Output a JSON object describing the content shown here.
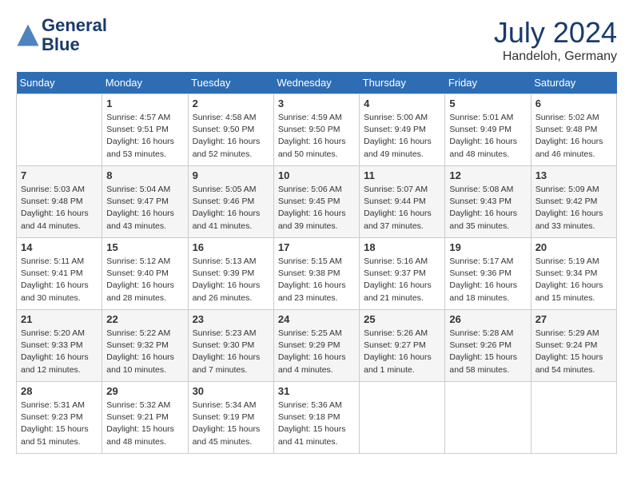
{
  "header": {
    "logo_line1": "General",
    "logo_line2": "Blue",
    "month_year": "July 2024",
    "location": "Handeloh, Germany"
  },
  "calendar": {
    "days_of_week": [
      "Sunday",
      "Monday",
      "Tuesday",
      "Wednesday",
      "Thursday",
      "Friday",
      "Saturday"
    ],
    "weeks": [
      [
        {
          "day": "",
          "sunrise": "",
          "sunset": "",
          "daylight": ""
        },
        {
          "day": "1",
          "sunrise": "Sunrise: 4:57 AM",
          "sunset": "Sunset: 9:51 PM",
          "daylight": "Daylight: 16 hours and 53 minutes."
        },
        {
          "day": "2",
          "sunrise": "Sunrise: 4:58 AM",
          "sunset": "Sunset: 9:50 PM",
          "daylight": "Daylight: 16 hours and 52 minutes."
        },
        {
          "day": "3",
          "sunrise": "Sunrise: 4:59 AM",
          "sunset": "Sunset: 9:50 PM",
          "daylight": "Daylight: 16 hours and 50 minutes."
        },
        {
          "day": "4",
          "sunrise": "Sunrise: 5:00 AM",
          "sunset": "Sunset: 9:49 PM",
          "daylight": "Daylight: 16 hours and 49 minutes."
        },
        {
          "day": "5",
          "sunrise": "Sunrise: 5:01 AM",
          "sunset": "Sunset: 9:49 PM",
          "daylight": "Daylight: 16 hours and 48 minutes."
        },
        {
          "day": "6",
          "sunrise": "Sunrise: 5:02 AM",
          "sunset": "Sunset: 9:48 PM",
          "daylight": "Daylight: 16 hours and 46 minutes."
        }
      ],
      [
        {
          "day": "7",
          "sunrise": "Sunrise: 5:03 AM",
          "sunset": "Sunset: 9:48 PM",
          "daylight": "Daylight: 16 hours and 44 minutes."
        },
        {
          "day": "8",
          "sunrise": "Sunrise: 5:04 AM",
          "sunset": "Sunset: 9:47 PM",
          "daylight": "Daylight: 16 hours and 43 minutes."
        },
        {
          "day": "9",
          "sunrise": "Sunrise: 5:05 AM",
          "sunset": "Sunset: 9:46 PM",
          "daylight": "Daylight: 16 hours and 41 minutes."
        },
        {
          "day": "10",
          "sunrise": "Sunrise: 5:06 AM",
          "sunset": "Sunset: 9:45 PM",
          "daylight": "Daylight: 16 hours and 39 minutes."
        },
        {
          "day": "11",
          "sunrise": "Sunrise: 5:07 AM",
          "sunset": "Sunset: 9:44 PM",
          "daylight": "Daylight: 16 hours and 37 minutes."
        },
        {
          "day": "12",
          "sunrise": "Sunrise: 5:08 AM",
          "sunset": "Sunset: 9:43 PM",
          "daylight": "Daylight: 16 hours and 35 minutes."
        },
        {
          "day": "13",
          "sunrise": "Sunrise: 5:09 AM",
          "sunset": "Sunset: 9:42 PM",
          "daylight": "Daylight: 16 hours and 33 minutes."
        }
      ],
      [
        {
          "day": "14",
          "sunrise": "Sunrise: 5:11 AM",
          "sunset": "Sunset: 9:41 PM",
          "daylight": "Daylight: 16 hours and 30 minutes."
        },
        {
          "day": "15",
          "sunrise": "Sunrise: 5:12 AM",
          "sunset": "Sunset: 9:40 PM",
          "daylight": "Daylight: 16 hours and 28 minutes."
        },
        {
          "day": "16",
          "sunrise": "Sunrise: 5:13 AM",
          "sunset": "Sunset: 9:39 PM",
          "daylight": "Daylight: 16 hours and 26 minutes."
        },
        {
          "day": "17",
          "sunrise": "Sunrise: 5:15 AM",
          "sunset": "Sunset: 9:38 PM",
          "daylight": "Daylight: 16 hours and 23 minutes."
        },
        {
          "day": "18",
          "sunrise": "Sunrise: 5:16 AM",
          "sunset": "Sunset: 9:37 PM",
          "daylight": "Daylight: 16 hours and 21 minutes."
        },
        {
          "day": "19",
          "sunrise": "Sunrise: 5:17 AM",
          "sunset": "Sunset: 9:36 PM",
          "daylight": "Daylight: 16 hours and 18 minutes."
        },
        {
          "day": "20",
          "sunrise": "Sunrise: 5:19 AM",
          "sunset": "Sunset: 9:34 PM",
          "daylight": "Daylight: 16 hours and 15 minutes."
        }
      ],
      [
        {
          "day": "21",
          "sunrise": "Sunrise: 5:20 AM",
          "sunset": "Sunset: 9:33 PM",
          "daylight": "Daylight: 16 hours and 12 minutes."
        },
        {
          "day": "22",
          "sunrise": "Sunrise: 5:22 AM",
          "sunset": "Sunset: 9:32 PM",
          "daylight": "Daylight: 16 hours and 10 minutes."
        },
        {
          "day": "23",
          "sunrise": "Sunrise: 5:23 AM",
          "sunset": "Sunset: 9:30 PM",
          "daylight": "Daylight: 16 hours and 7 minutes."
        },
        {
          "day": "24",
          "sunrise": "Sunrise: 5:25 AM",
          "sunset": "Sunset: 9:29 PM",
          "daylight": "Daylight: 16 hours and 4 minutes."
        },
        {
          "day": "25",
          "sunrise": "Sunrise: 5:26 AM",
          "sunset": "Sunset: 9:27 PM",
          "daylight": "Daylight: 16 hours and 1 minute."
        },
        {
          "day": "26",
          "sunrise": "Sunrise: 5:28 AM",
          "sunset": "Sunset: 9:26 PM",
          "daylight": "Daylight: 15 hours and 58 minutes."
        },
        {
          "day": "27",
          "sunrise": "Sunrise: 5:29 AM",
          "sunset": "Sunset: 9:24 PM",
          "daylight": "Daylight: 15 hours and 54 minutes."
        }
      ],
      [
        {
          "day": "28",
          "sunrise": "Sunrise: 5:31 AM",
          "sunset": "Sunset: 9:23 PM",
          "daylight": "Daylight: 15 hours and 51 minutes."
        },
        {
          "day": "29",
          "sunrise": "Sunrise: 5:32 AM",
          "sunset": "Sunset: 9:21 PM",
          "daylight": "Daylight: 15 hours and 48 minutes."
        },
        {
          "day": "30",
          "sunrise": "Sunrise: 5:34 AM",
          "sunset": "Sunset: 9:19 PM",
          "daylight": "Daylight: 15 hours and 45 minutes."
        },
        {
          "day": "31",
          "sunrise": "Sunrise: 5:36 AM",
          "sunset": "Sunset: 9:18 PM",
          "daylight": "Daylight: 15 hours and 41 minutes."
        },
        {
          "day": "",
          "sunrise": "",
          "sunset": "",
          "daylight": ""
        },
        {
          "day": "",
          "sunrise": "",
          "sunset": "",
          "daylight": ""
        },
        {
          "day": "",
          "sunrise": "",
          "sunset": "",
          "daylight": ""
        }
      ]
    ]
  }
}
